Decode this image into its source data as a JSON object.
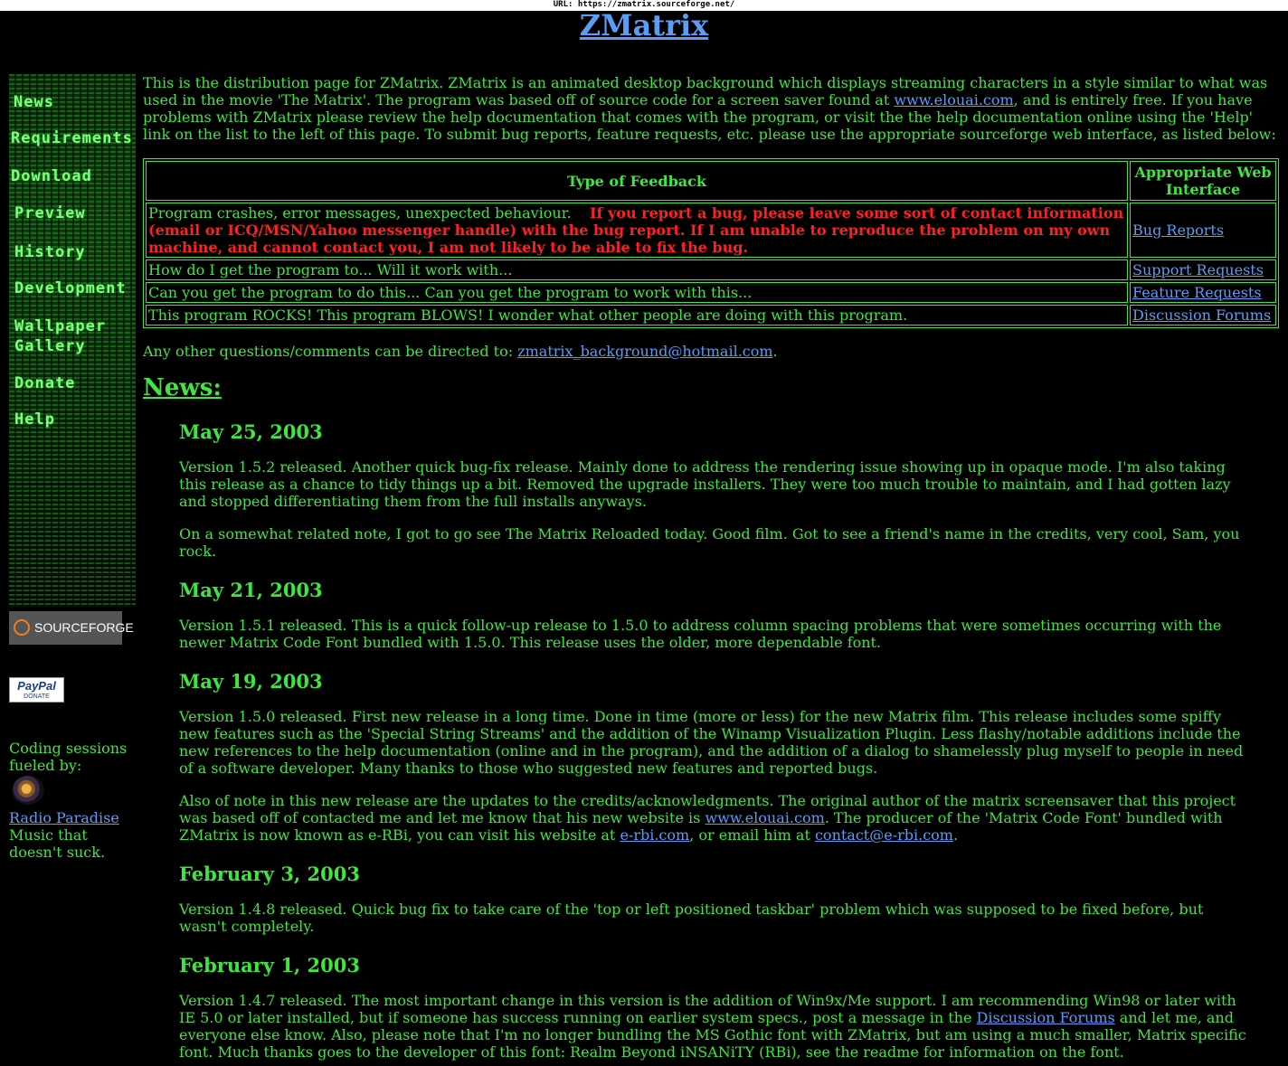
{
  "url_bar": "URL: https://zmatrix.sourceforge.net/",
  "site_title": "ZMatrix",
  "sidebar": {
    "nav": [
      "News",
      "Requirements",
      "Download",
      "Preview",
      "History",
      "Development",
      "Wallpaper",
      "Gallery",
      "Donate",
      "Help"
    ],
    "sourceforge_label": "SOURCEFORGE",
    "paypal_label": "PayPal",
    "paypal_sub": "DONATE",
    "coding_text": "Coding sessions fueled by:",
    "radio_link": "Radio Paradise",
    "radio_tagline": "Music that doesn't suck."
  },
  "intro": {
    "part1": "This is the distribution page for ZMatrix.  ZMatrix is an animated desktop background which displays streaming characters in a style similar to what was used in the movie 'The Matrix'.  The program was based off of source code for a screen saver found at ",
    "link": "www.elouai.com",
    "part2": ", and is entirely free.  If you have problems with ZMatrix please review the help documentation that comes with the program, or visit the the help documentation online using the 'Help' link on the list to the left of this page. To submit bug reports, feature requests, etc. please use the appropriate sourceforge web interface, as listed below:"
  },
  "feedback_table": {
    "headers": [
      "Type of Feedback",
      "Appropriate Web Interface"
    ],
    "rows": [
      {
        "type": "Program crashes, error messages, unexpected behaviour.",
        "warning": "If you report a bug, please leave some sort of contact information (email or ICQ/MSN/Yahoo messenger handle) with the bug report.   If I am unable to reproduce the problem on my own machine, and cannot contact you, I am not likely to be able to fix the bug.",
        "link": "Bug Reports"
      },
      {
        "type": "How do I get the program to...  Will it work with...",
        "link": "Support Requests"
      },
      {
        "type": "Can you get the program to do this...  Can you get the program to work with this...",
        "link": "Feature Requests"
      },
      {
        "type": "This program ROCKS!  This program BLOWS!  I wonder what other people are doing with this program.",
        "link": "Discussion Forums"
      }
    ]
  },
  "contact": {
    "prefix": "Any other questions/comments can be directed to: ",
    "email": "zmatrix_background@hotmail.com",
    "suffix": "."
  },
  "news_heading": "News:",
  "news": [
    {
      "date": "May 25, 2003",
      "p1": "Version 1.5.2 released.  Another quick bug-fix release.  Mainly done to address the rendering issue showing up in opaque mode.  I'm also taking this release as a chance to tidy things up a bit.  Removed the upgrade installers.  They were too much trouble to maintain, and I had gotten lazy and stopped differentiating them from the full installs anyways.",
      "p2": "On a somewhat related note, I got to go see The Matrix Reloaded today.  Good film.  Got to see a friend's name in the credits, very cool, Sam, you rock."
    },
    {
      "date": "May 21, 2003",
      "p1": "Version 1.5.1 released.  This is a quick follow-up release to 1.5.0 to address column spacing problems that were sometimes occurring with the newer Matrix Code Font bundled with 1.5.0.  This release uses the older, more dependable font."
    },
    {
      "date": "May 19, 2003",
      "p1": "Version 1.5.0 released.  First new release in a long time.  Done in time (more or less) for the new Matrix film.  This release includes some spiffy new features such as the 'Special String Streams' and the addition of the Winamp Visualization Plugin.  Less flashy/notable additions include the new references to the help documentation (online and in the program), and the addition of a dialog to shamelessly plug myself to people in need of a software developer.  Many thanks to those who suggested new features and reported bugs.",
      "p2a": "Also of note in this new release are the updates to the credits/acknowledgments.  The original author of the matrix screensaver that this project was based off of contacted me and let me know that his new website is ",
      "link1": "www.elouai.com",
      "p2b": ".  The producer of the 'Matrix Code Font' bundled with ZMatrix is now known as e-RBi, you can visit his website at ",
      "link2": "e-rbi.com",
      "p2c": ", or email him at ",
      "link3": "contact@e-rbi.com",
      "p2d": "."
    },
    {
      "date": "February 3, 2003",
      "p1": "Version 1.4.8 released.  Quick bug fix to take care of the 'top or left positioned taskbar' problem which was supposed to be fixed before, but wasn't completely."
    },
    {
      "date": "February 1, 2003",
      "p1a": "Version 1.4.7 released.  The most important change in this version is the addition of Win9x/Me support.  I am recommending Win98 or later with IE 5.0 or later installed, but if someone has success running on earlier system specs., post a message in the ",
      "link": "Discussion Forums",
      "p1b": " and let me, and everyone else know.  Also, please note that I'm no longer bundling the MS Gothic font with ZMatrix, but am using a much smaller, Matrix specific font.  Much thanks goes to the developer of this font: Realm Beyond iNSANiTY (RBi), see the readme for information on the font."
    }
  ]
}
